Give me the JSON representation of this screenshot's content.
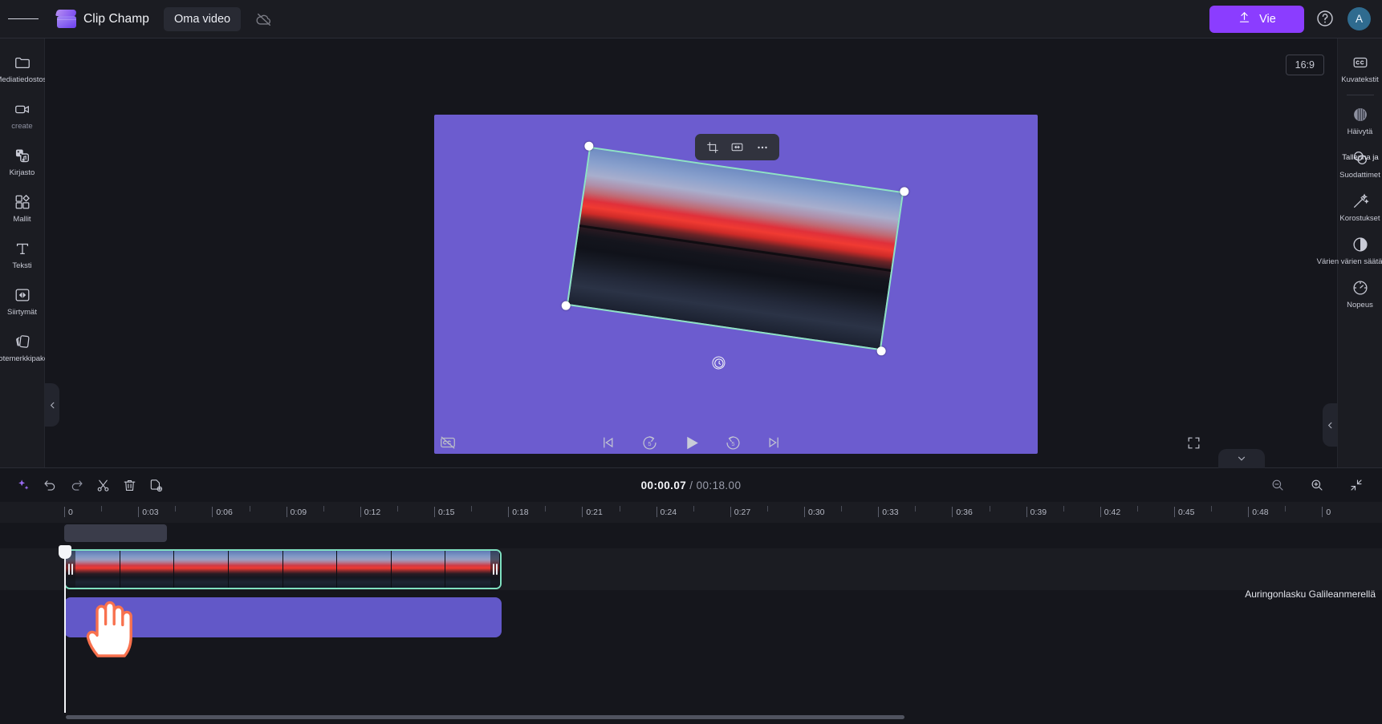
{
  "app": {
    "brand_name": "Clip Champ",
    "project_title": "Oma video",
    "export_label": "Vie",
    "avatar_initial": "A",
    "menu_icon": "hamburger-menu-icon",
    "cloud_icon": "cloud-off-icon",
    "help_icon": "help-circle-icon"
  },
  "left_sidebar": {
    "items": [
      {
        "label": "Mediatiedostosi",
        "icon": "folder-icon"
      },
      {
        "label": "create",
        "icon": "video-camera-icon"
      },
      {
        "label": "Kirjasto",
        "icon": "library-shapes-icon"
      },
      {
        "label": "Mallit",
        "icon": "templates-grid-icon"
      },
      {
        "label": "Teksti",
        "icon": "text-t-icon"
      },
      {
        "label": "Siirtymät",
        "icon": "transitions-icon"
      },
      {
        "label": "Tuotemerkkipaketti",
        "icon": "brand-kit-icon"
      }
    ]
  },
  "right_sidebar": {
    "items": [
      {
        "label": "Kuvatekstit",
        "icon": "closed-captions-icon"
      },
      {
        "label": "Häivytä",
        "icon": "fade-icon"
      },
      {
        "label": "Suodattimet",
        "icon": "filters-icon"
      },
      {
        "label": "Korostukset",
        "icon": "magic-wand-icon"
      },
      {
        "label": "Värien värien säätäminen",
        "icon": "contrast-circle-icon"
      },
      {
        "label": "Nopeus",
        "icon": "speedometer-icon"
      }
    ],
    "tooltip": "Tallenna ja"
  },
  "preview": {
    "aspect_ratio": "16:9",
    "canvas_color": "#6c5ccf",
    "selection_color": "#8fe3c4",
    "float_toolbar": [
      {
        "name": "crop-icon"
      },
      {
        "name": "fit-to-frame-icon"
      },
      {
        "name": "more-options-icon"
      }
    ]
  },
  "playback": {
    "captions_icon": "captions-off-icon",
    "controls": [
      {
        "name": "skip-to-start-icon"
      },
      {
        "name": "rewind-5s-icon"
      },
      {
        "name": "play-icon"
      },
      {
        "name": "forward-5s-icon"
      },
      {
        "name": "skip-to-end-icon"
      }
    ],
    "fullscreen_icon": "fullscreen-icon"
  },
  "timeline": {
    "toolbar": [
      {
        "name": "ai-sparkle-icon"
      },
      {
        "name": "undo-icon"
      },
      {
        "name": "redo-icon"
      },
      {
        "name": "split-scissors-icon"
      },
      {
        "name": "delete-trash-icon"
      },
      {
        "name": "duplicate-icon"
      }
    ],
    "current_time": "00:00.07",
    "separator": "/",
    "total_time": "00:18.00",
    "zoom_controls": [
      {
        "name": "zoom-out-icon"
      },
      {
        "name": "zoom-in-icon"
      },
      {
        "name": "fit-timeline-icon"
      }
    ],
    "ruler_labels": [
      "0",
      "0:03",
      "0:06",
      "0:09",
      "0:12",
      "0:15",
      "0:18",
      "0:21",
      "0:24",
      "0:27",
      "0:30",
      "0:33",
      "0:36",
      "0:39",
      "0:42",
      "0:45",
      "0:48",
      "0"
    ],
    "clip_title": "Auringonlasku Galileanmerellä",
    "video_clip_name": "video-clip",
    "audio_clip_name": "purple-clip"
  }
}
